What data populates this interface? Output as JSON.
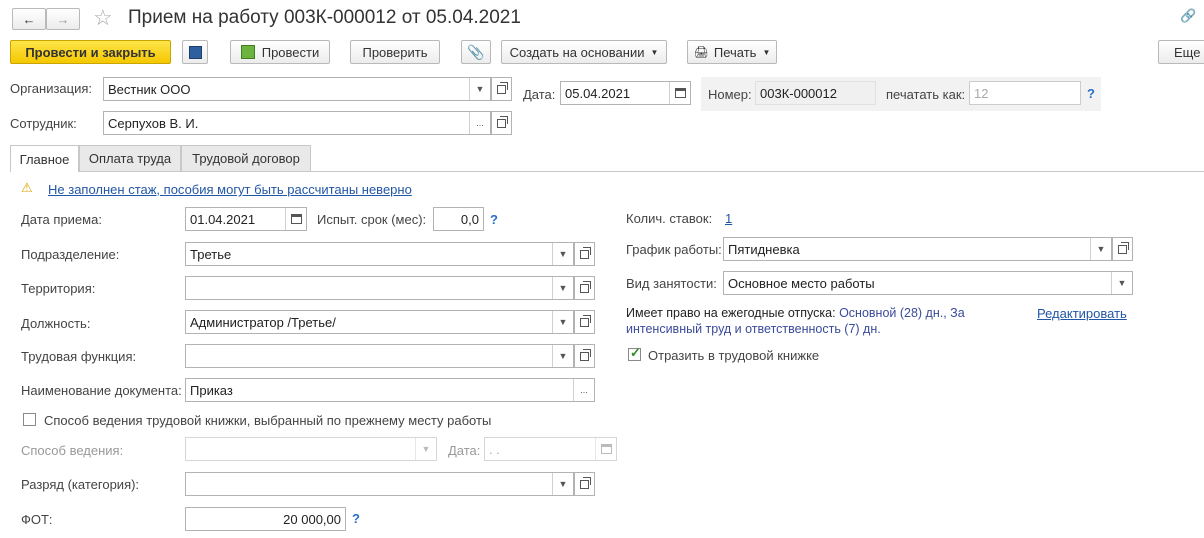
{
  "window": {
    "title": "Прием на работу 003К-000012 от 05.04.2021"
  },
  "toolbar": {
    "post_close": "Провести и закрыть",
    "post": "Провести",
    "check": "Проверить",
    "create_based": "Создать на основании",
    "print": "Печать",
    "more": "Еще"
  },
  "header": {
    "org_label": "Организация:",
    "org_value": "Вестник ООО",
    "date_label": "Дата:",
    "date_value": "05.04.2021",
    "number_label": "Номер:",
    "number_value": "003К-000012",
    "print_as_label": "печатать как:",
    "print_as_placeholder": "12",
    "employee_label": "Сотрудник:",
    "employee_value": "Серпухов В. И.",
    "help_mark": "?"
  },
  "tabs": [
    "Главное",
    "Оплата труда",
    "Трудовой договор"
  ],
  "warning": "Не заполнен стаж, пособия могут быть рассчитаны неверно",
  "main": {
    "hire_date_label": "Дата приема:",
    "hire_date_value": "01.04.2021",
    "probation_label": "Испыт. срок (мес):",
    "probation_value": "0,0",
    "department_label": "Подразделение:",
    "department_value": "Третье",
    "territory_label": "Территория:",
    "territory_value": "",
    "position_label": "Должность:",
    "position_value": "Администратор /Третье/",
    "labor_function_label": "Трудовая функция:",
    "labor_function_value": "",
    "doc_name_label": "Наименование документа:",
    "doc_name_value": "Приказ",
    "workbook_method_checkbox": "Способ ведения трудовой книжки, выбранный по прежнему месту работы",
    "method_label": "Способ ведения:",
    "method_date_label": "Дата:",
    "method_date_value": " .  .",
    "grade_label": "Разряд (категория):",
    "grade_value": "",
    "fot_label": "ФОТ:",
    "fot_value": "20 000,00"
  },
  "right": {
    "rates_label": "Колич. ставок:",
    "rates_value": "1",
    "schedule_label": "График работы:",
    "schedule_value": "Пятидневка",
    "employment_label": "Вид занятости:",
    "employment_value": "Основное место работы",
    "vacation_label": "Имеет право на ежегодные отпуска:",
    "vacation_value_line1": "Основной (28) дн., За",
    "vacation_value_line2": "интенсивный труд и ответственность (7) дн.",
    "edit_link": "Редактировать",
    "reflect_checkbox": "Отразить в трудовой книжке"
  }
}
